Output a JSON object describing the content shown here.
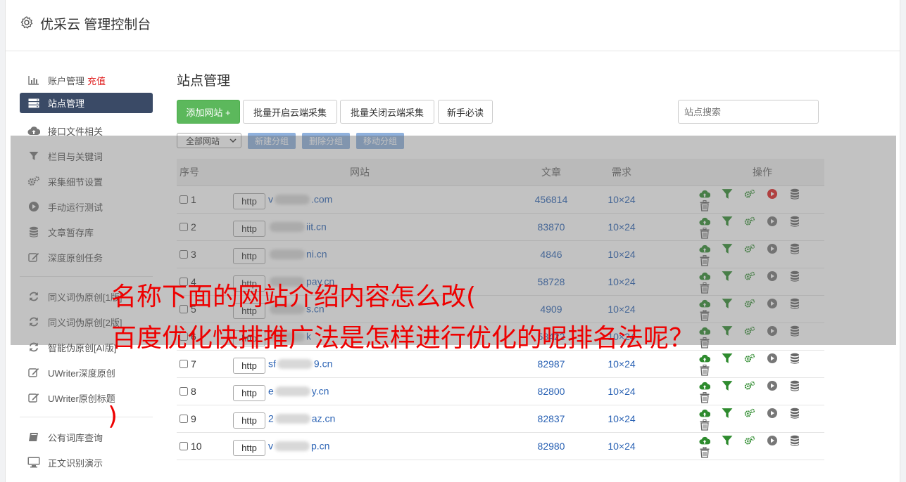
{
  "header": {
    "title": "优采云 管理控制台",
    "icon": "gear-icon"
  },
  "sidebar": {
    "group1": [
      {
        "label": "账户管理",
        "extra": "充值",
        "icon": "bar-chart-icon"
      },
      {
        "label": "站点管理",
        "icon": "server-icon",
        "active": true
      },
      {
        "label": "接口文件相关",
        "icon": "cloud-upload-icon"
      },
      {
        "label": "栏目与关键词",
        "icon": "filter-icon"
      },
      {
        "label": "采集细节设置",
        "icon": "cogs-icon"
      },
      {
        "label": "手动运行测试",
        "icon": "play-circle-icon"
      },
      {
        "label": "文章暂存库",
        "icon": "database-icon"
      },
      {
        "label": "深度原创任务",
        "icon": "edit-icon"
      }
    ],
    "group2": [
      {
        "label": "同义词伪原创[1版]",
        "icon": "refresh-icon"
      },
      {
        "label": "同义词伪原创[2版]",
        "icon": "refresh-icon"
      },
      {
        "label": "智能伪原创[AI版]",
        "icon": "refresh-icon"
      },
      {
        "label": "UWriter深度原创",
        "icon": "edit-icon"
      },
      {
        "label": "UWriter原创标题",
        "icon": "edit-icon"
      }
    ],
    "group3": [
      {
        "label": "公有词库查询",
        "icon": "book-icon"
      },
      {
        "label": "正文识别演示",
        "icon": "monitor-icon"
      }
    ]
  },
  "main": {
    "title": "站点管理",
    "buttons": {
      "add": "添加网站 +",
      "batch_on": "批量开启云端采集",
      "batch_off": "批量关闭云端采集",
      "guide": "新手必读"
    },
    "search_placeholder": "站点搜索",
    "group_select": "全部网站",
    "group_buttons": {
      "new": "新建分组",
      "delete": "删除分组",
      "move": "移动分组"
    },
    "table": {
      "headers": {
        "num": "序号",
        "site": "网站",
        "articles": "文章",
        "demand": "需求",
        "ops": "操作"
      },
      "http_label": "http",
      "rows": [
        {
          "num": "1",
          "prefix": "v",
          "domain": ".com",
          "articles": "456814",
          "demand": "10×24",
          "play_color": "#e02020"
        },
        {
          "num": "2",
          "prefix": "",
          "domain": "iit.cn",
          "articles": "83870",
          "demand": "10×24",
          "play_color": "#777777"
        },
        {
          "num": "3",
          "prefix": "",
          "domain": "ni.cn",
          "articles": "4846",
          "demand": "10×24",
          "play_color": "#777777"
        },
        {
          "num": "4",
          "prefix": "",
          "domain": "pay.cn",
          "articles": "58728",
          "demand": "10×24",
          "play_color": "#777777"
        },
        {
          "num": "5",
          "prefix": "",
          "domain": "s.cn",
          "articles": "4909",
          "demand": "10×24",
          "play_color": "#777777"
        },
        {
          "num": "6",
          "prefix": "",
          "domain": "k",
          "articles": "58422",
          "demand": "10×24",
          "play_color": "#777777"
        },
        {
          "num": "7",
          "prefix": "sf",
          "domain": "9.cn",
          "articles": "82987",
          "demand": "10×24",
          "play_color": "#777777"
        },
        {
          "num": "8",
          "prefix": "e",
          "domain": "y.cn",
          "articles": "82800",
          "demand": "10×24",
          "play_color": "#777777"
        },
        {
          "num": "9",
          "prefix": "2",
          "domain": "az.cn",
          "articles": "82837",
          "demand": "10×24",
          "play_color": "#777777"
        },
        {
          "num": "10",
          "prefix": "v",
          "domain": "p.cn",
          "articles": "82980",
          "demand": "10×24",
          "play_color": "#777777"
        }
      ]
    }
  },
  "watermark": {
    "line1": "名称下面的网站介绍内容怎么改(",
    "line2": "百度优化快排推广法是怎样进行优化的呢排名法呢？",
    "line3": ")"
  }
}
